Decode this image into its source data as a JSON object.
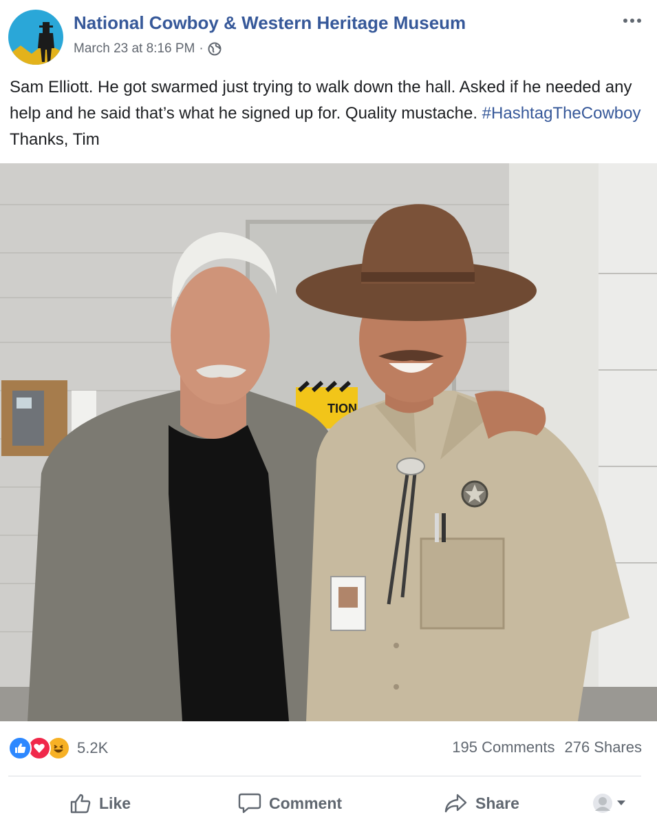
{
  "post": {
    "page_name": "National Cowboy & Western Heritage Museum",
    "timestamp": "March 23 at 8:16 PM",
    "meta_separator": "·",
    "text_before_hashtag": "Sam Elliott. He got swarmed just trying to walk down the hall. Asked if he needed any help and he said that’s what he signed up for. Quality mustache. ",
    "hashtag": "#HashtagTheCowboy",
    "text_after_hashtag": " Thanks, Tim",
    "photo_sign_text": "TION"
  },
  "reactions": {
    "types": [
      "like-icon",
      "love-icon",
      "haha-icon"
    ],
    "count": "5.2K"
  },
  "stats": {
    "comments": "195 Comments",
    "shares": "276 Shares"
  },
  "actions": {
    "like_label": "Like",
    "comment_label": "Comment",
    "share_label": "Share"
  },
  "colors": {
    "link": "#365899",
    "meta": "#616770",
    "like_blue": "#2d88ff",
    "love_red": "#f0284a",
    "haha_yellow": "#f7b125"
  }
}
